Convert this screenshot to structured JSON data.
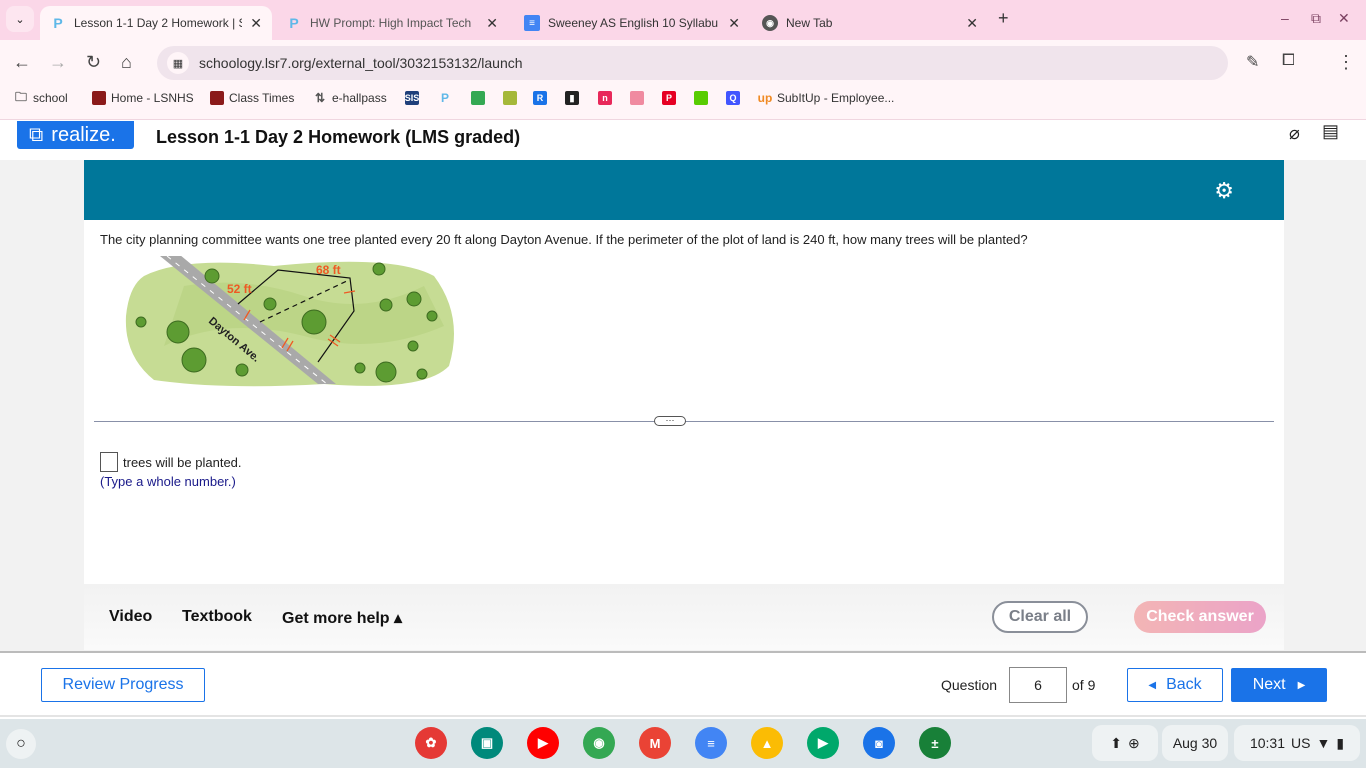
{
  "browser": {
    "tabs": [
      {
        "label": "Lesson 1-1 Day 2 Homework | S",
        "icon": "pearson-p-icon",
        "active": true
      },
      {
        "label": "HW Prompt: High Impact Tech",
        "icon": "pearson-p-icon"
      },
      {
        "label": "Sweeney AS English 10 Syllabu",
        "icon": "google-docs-icon"
      },
      {
        "label": "New Tab",
        "icon": "chrome-icon"
      }
    ],
    "url": "schoology.lsr7.org/external_tool/3032153132/launch",
    "bookmarks": [
      {
        "label": "school",
        "icon": "folder-icon"
      },
      {
        "label": "Home - LSNHS",
        "icon": "school-mascot-icon"
      },
      {
        "label": "Class Times",
        "icon": "school-mascot-icon"
      },
      {
        "label": "e-hallpass",
        "icon": "hallpass-icon"
      },
      {
        "label": "",
        "icon": "sis-icon",
        "text": "SIS"
      },
      {
        "label": "",
        "icon": "pearson-p-icon"
      },
      {
        "label": "",
        "icon": "google-drive-icon"
      },
      {
        "label": "",
        "icon": "pear-icon"
      },
      {
        "label": "",
        "icon": "r-icon"
      },
      {
        "label": "",
        "icon": "book-icon"
      },
      {
        "label": "",
        "icon": "n-icon"
      },
      {
        "label": "",
        "icon": "chat-icon"
      },
      {
        "label": "",
        "icon": "pinterest-icon"
      },
      {
        "label": "",
        "icon": "duolingo-icon"
      },
      {
        "label": "",
        "icon": "quizlet-icon"
      },
      {
        "label": "SubItUp - Employee...",
        "icon": "subitup-icon"
      }
    ]
  },
  "app": {
    "logo": "realize.",
    "title": "Lesson 1-1 Day 2 Homework (LMS graded)",
    "question_text": "The city planning committee wants one tree planted every 20 ft along Dayton Avenue. If the perimeter of the plot of land is 240 ft, how many trees will be planted?",
    "figure": {
      "side1": "52 ft",
      "side2": "68 ft",
      "street": "Dayton Ave."
    },
    "answer_suffix": "trees will be planted.",
    "answer_value": "",
    "hint": "(Type a whole number.)",
    "help": {
      "video": "Video",
      "textbook": "Textbook",
      "more": "Get more help ▴"
    },
    "clear_all": "Clear all",
    "check_answer": "Check answer",
    "footer": {
      "review": "Review Progress",
      "question_label": "Question",
      "question_number": "6",
      "of": "of 9",
      "back": "Back",
      "next": "Next"
    },
    "colors": {
      "teal": "#00779a",
      "primary": "#1a73e8"
    }
  },
  "shelf": {
    "apps": [
      "canvas-icon",
      "classroom-icon",
      "youtube-icon",
      "chrome-icon",
      "gmail-icon",
      "docs-icon",
      "drive-icon",
      "play-store-icon",
      "camera-icon",
      "calculator-icon"
    ],
    "date": "Aug 30",
    "time": "10:31",
    "locale": "US"
  }
}
